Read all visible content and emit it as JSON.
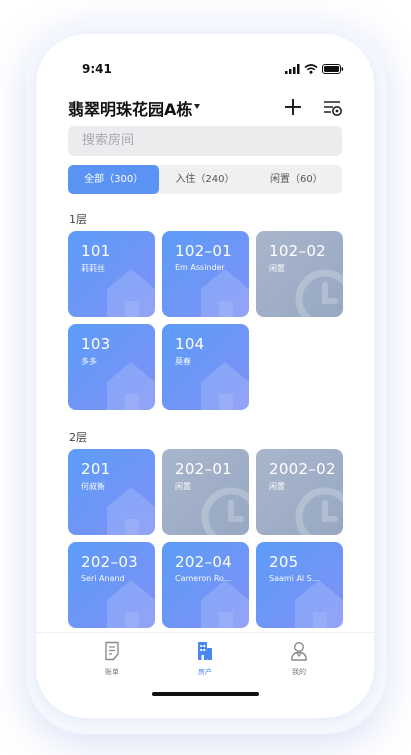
{
  "status": {
    "time": "9:41"
  },
  "header": {
    "title": "翡翠明珠花园A栋"
  },
  "search": {
    "placeholder": "搜索房间"
  },
  "tabs": [
    {
      "label": "全部（300）",
      "active": true
    },
    {
      "label": "入住（240）",
      "active": false
    },
    {
      "label": "闲置（60）",
      "active": false
    }
  ],
  "floors": [
    {
      "label": "1层"
    },
    {
      "label": "2层"
    }
  ],
  "rooms": [
    {
      "num": "101",
      "sub": "莉莉丝",
      "status": "occupied",
      "icon": "house-icon"
    },
    {
      "num": "102–01",
      "sub": "Em Assinder",
      "status": "occupied",
      "icon": "house-icon"
    },
    {
      "num": "102–02",
      "sub": "闲置",
      "status": "vacant",
      "icon": "clock-icon"
    },
    {
      "num": "103",
      "sub": "多多",
      "status": "occupied",
      "icon": "house-icon"
    },
    {
      "num": "104",
      "sub": "莫春",
      "status": "occupied",
      "icon": "house-icon"
    },
    {
      "num": "201",
      "sub": "何叔衡",
      "status": "occupied",
      "icon": "house-icon"
    },
    {
      "num": "202–01",
      "sub": "闲置",
      "status": "vacant",
      "icon": "clock-icon"
    },
    {
      "num": "2002–02",
      "sub": "闲置",
      "status": "vacant",
      "icon": "clock-icon"
    },
    {
      "num": "202–03",
      "sub": "Seri Anand",
      "status": "occupied",
      "icon": "house-icon"
    },
    {
      "num": "202–04",
      "sub": "Cameron Ro...",
      "status": "occupied",
      "icon": "house-icon"
    },
    {
      "num": "205",
      "sub": "Saami Al S...",
      "status": "occupied",
      "icon": "house-icon"
    }
  ],
  "tabbar": [
    {
      "label": "账单",
      "icon": "bill-icon",
      "active": false
    },
    {
      "label": "房产",
      "icon": "building-icon",
      "active": true
    },
    {
      "label": "我的",
      "icon": "profile-icon",
      "active": false
    }
  ],
  "colors": {
    "accent": "#5b93f5",
    "occupied": "#6b98f7",
    "vacant": "#a2b1c8"
  }
}
